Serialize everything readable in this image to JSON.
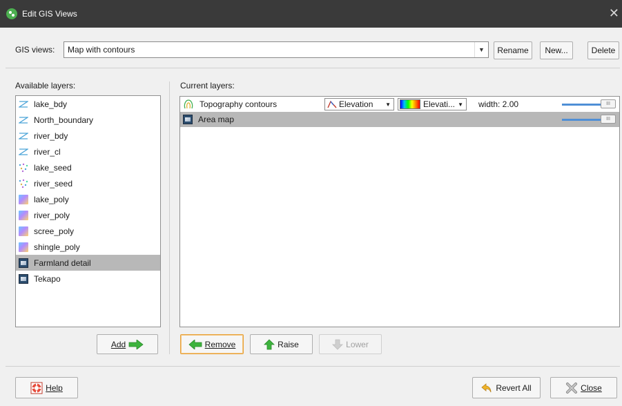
{
  "window": {
    "title": "Edit GIS Views"
  },
  "gis_views": {
    "label": "GIS views:",
    "selected": "Map with contours"
  },
  "top_buttons": {
    "rename": "Rename",
    "new": "New...",
    "delete": "Delete"
  },
  "available": {
    "label": "Available layers:",
    "items": [
      {
        "label": "lake_bdy",
        "icon": "line-layer-icon"
      },
      {
        "label": "North_boundary",
        "icon": "line-layer-icon"
      },
      {
        "label": "river_bdy",
        "icon": "line-layer-icon"
      },
      {
        "label": "river_cl",
        "icon": "line-layer-icon"
      },
      {
        "label": "lake_seed",
        "icon": "points-layer-icon"
      },
      {
        "label": "river_seed",
        "icon": "points-layer-icon"
      },
      {
        "label": "lake_poly",
        "icon": "polygon-layer-icon"
      },
      {
        "label": "river_poly",
        "icon": "polygon-layer-icon"
      },
      {
        "label": "scree_poly",
        "icon": "polygon-layer-icon"
      },
      {
        "label": "shingle_poly",
        "icon": "polygon-layer-icon"
      },
      {
        "label": "Farmland detail",
        "icon": "image-layer-icon",
        "selected": true
      },
      {
        "label": "Tekapo",
        "icon": "image-layer-icon"
      }
    ],
    "add_label": "Add"
  },
  "current": {
    "label": "Current layers:",
    "layers": [
      {
        "label": "Topography contours",
        "icon": "contour-icon",
        "attribute": "Elevation",
        "colormap": "Elevati...",
        "width_text": "width:  2.00"
      },
      {
        "label": "Area map",
        "icon": "image-layer-icon",
        "selected": true
      }
    ],
    "remove_label": "Remove",
    "raise_label": "Raise",
    "lower_label": "Lower"
  },
  "footer": {
    "help": "Help",
    "revert_all": "Revert All",
    "close": "Close"
  },
  "colors": {
    "title_bar": "#3a3a3a",
    "selection": "#b8b8b8",
    "arrow_green": "#3db33d",
    "focus_orange": "#e8a33c",
    "slider_blue": "#4f8fd6"
  }
}
